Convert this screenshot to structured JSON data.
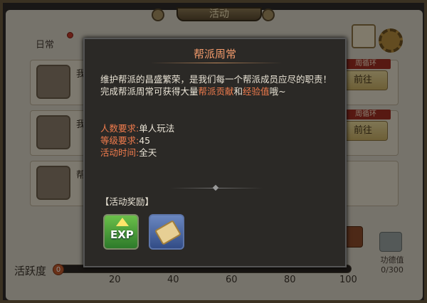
{
  "window": {
    "title": "活动"
  },
  "tabs": {
    "daily": "日常"
  },
  "rows": [
    {
      "name_char": "我",
      "week_tag": "周循环",
      "go": "前往"
    },
    {
      "name_char": "我",
      "week_tag": "周循环",
      "go": "前往"
    },
    {
      "name_char": "帮",
      "week_tag": "",
      "go": ""
    }
  ],
  "popup": {
    "title": "帮派周常",
    "desc_line1": "维护帮派的昌盛繁荣，是我们每一个帮派成员应尽的职责！",
    "desc_line2_pre": "完成帮派周常可获得大量",
    "desc_hl1": "帮派贡献",
    "desc_mid": "和",
    "desc_hl2": "经验值",
    "desc_post": "哦~",
    "req_people_k": "人数要求:",
    "req_people_v": "单人玩法",
    "req_level_k": "等级要求:",
    "req_level_v": "45",
    "req_time_k": "活动时间:",
    "req_time_v": "全天",
    "reward_label": "【活动奖励】",
    "reward_exp_text": "EXP"
  },
  "activity": {
    "label": "活跃度",
    "value": "0",
    "ticks": [
      "20",
      "40",
      "60",
      "80",
      "100"
    ]
  },
  "merit": {
    "label": "功德值",
    "value": "0/300"
  },
  "colors": {
    "accent": "#f07c4d",
    "title": "#f29a6b",
    "popup_bg": "#2b2926"
  }
}
